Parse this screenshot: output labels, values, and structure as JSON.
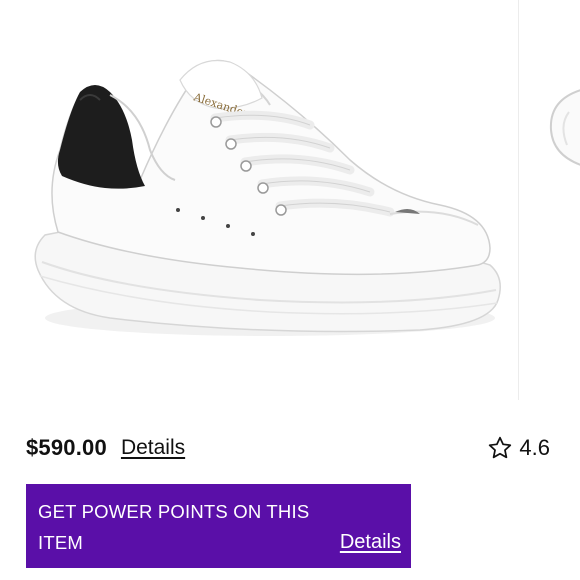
{
  "product": {
    "image_alt": "white-leather-sneaker-black-heel-tab",
    "shoe_logo_text": "Alexander",
    "price": "$590.00",
    "details_link": "Details",
    "rating": "4.6",
    "rating_icon": "star-outline-icon"
  },
  "promo": {
    "text": "GET POWER POINTS ON THIS ITEM",
    "details_link": "Details",
    "background_color": "#5a0fa8"
  }
}
